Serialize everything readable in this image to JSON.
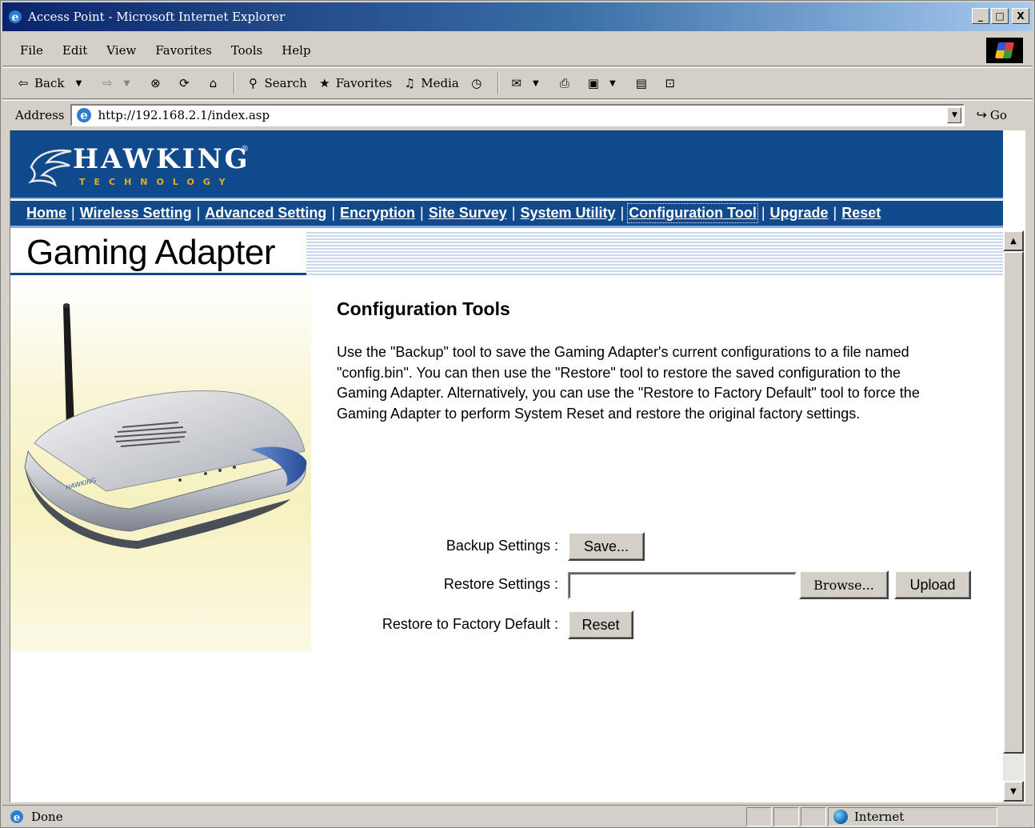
{
  "window": {
    "title": "Access Point - Microsoft Internet Explorer",
    "minimize": "_",
    "maximize": "□",
    "close": "X"
  },
  "menu": [
    "File",
    "Edit",
    "View",
    "Favorites",
    "Tools",
    "Help"
  ],
  "toolbar": {
    "back": "Back",
    "search": "Search",
    "favorites": "Favorites",
    "media": "Media"
  },
  "address": {
    "label": "Address",
    "url": "http://192.168.2.1/index.asp",
    "go": "Go"
  },
  "brand": {
    "name": "HAWKING",
    "sub": "TECHNOLOGY",
    "reg": "®"
  },
  "nav": [
    {
      "label": "Home"
    },
    {
      "label": "Wireless Setting"
    },
    {
      "label": "Advanced Setting"
    },
    {
      "label": "Encryption"
    },
    {
      "label": "Site Survey"
    },
    {
      "label": "System Utility"
    },
    {
      "label": "Configuration Tool",
      "active": true
    },
    {
      "label": "Upgrade"
    },
    {
      "label": "Reset"
    }
  ],
  "page": {
    "title": "Gaming Adapter",
    "heading": "Configuration Tools",
    "description": "Use the \"Backup\" tool to save the Gaming Adapter's current configurations to a file named \"config.bin\". You can then use the \"Restore\" tool to restore the saved configuration to the Gaming Adapter. Alternatively, you can use the \"Restore to Factory Default\" tool to force the Gaming Adapter to perform System Reset and restore the original factory settings."
  },
  "form": {
    "backup_label": "Backup Settings :",
    "save_button": "Save...",
    "restore_label": "Restore Settings :",
    "restore_value": "",
    "browse_button": "Browse...",
    "upload_button": "Upload",
    "factory_label": "Restore to Factory Default :",
    "reset_button": "Reset"
  },
  "status": {
    "text": "Done",
    "zone": "Internet"
  },
  "colors": {
    "banner": "#104a8c",
    "title_bar": "#0a246a",
    "logo_accent": "#e0b020"
  }
}
